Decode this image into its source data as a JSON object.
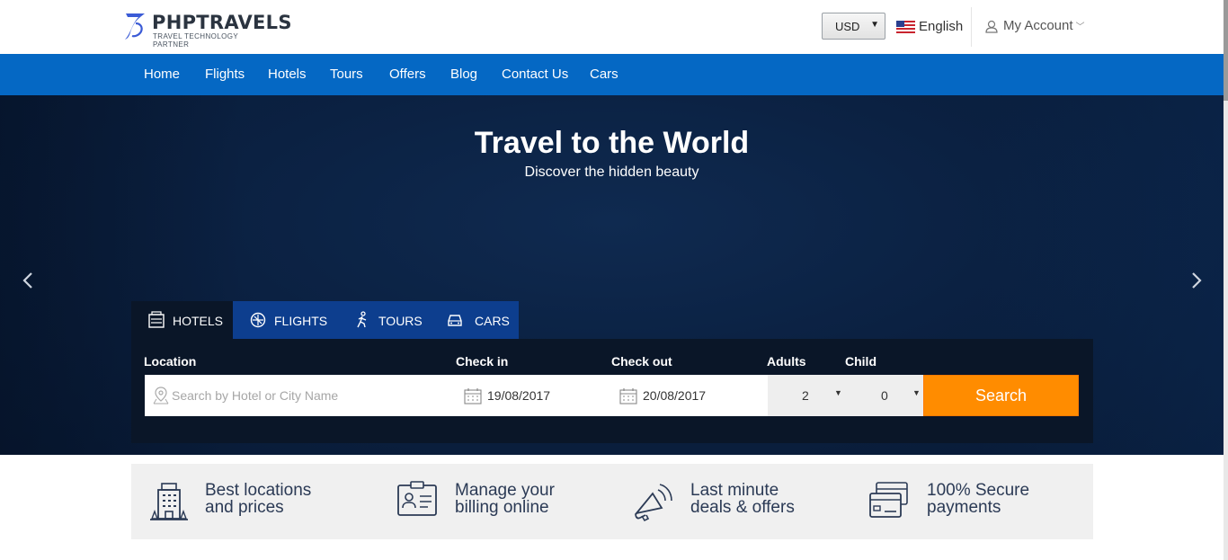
{
  "brand": {
    "name": "PHPTRAVELS",
    "tagline": "TRAVEL TECHNOLOGY PARTNER",
    "accent": "#0568c4",
    "logo_color": "#3b5bd6"
  },
  "topbar": {
    "currency": "USD",
    "language": "English",
    "account": "My Account"
  },
  "nav": {
    "items": [
      "Home",
      "Flights",
      "Hotels",
      "Tours",
      "Offers",
      "Blog",
      "Contact Us",
      "Cars"
    ]
  },
  "hero": {
    "title": "Travel to the World",
    "subtitle": "Discover the hidden beauty"
  },
  "tabs": [
    {
      "label": "HOTELS",
      "icon": "hotel-icon",
      "active": true
    },
    {
      "label": "FLIGHTS",
      "icon": "airplane-icon",
      "active": false
    },
    {
      "label": "TOURS",
      "icon": "hiker-icon",
      "active": false
    },
    {
      "label": "CARS",
      "icon": "car-icon",
      "active": false
    }
  ],
  "search": {
    "labels": {
      "location": "Location",
      "checkin": "Check in",
      "checkout": "Check out",
      "adults": "Adults",
      "child": "Child"
    },
    "location_placeholder": "Search by Hotel or City Name",
    "checkin_value": "19/08/2017",
    "checkout_value": "20/08/2017",
    "adults_value": "2",
    "child_value": "0",
    "button": "Search",
    "button_color": "#ff8c00"
  },
  "features": [
    {
      "line1": "Best locations",
      "line2": "and prices",
      "icon": "building-icon"
    },
    {
      "line1": "Manage your",
      "line2": "billing online",
      "icon": "id-card-icon"
    },
    {
      "line1": "Last minute",
      "line2": "deals & offers",
      "icon": "megaphone-icon"
    },
    {
      "line1": "100% Secure",
      "line2": "payments",
      "icon": "credit-card-icon"
    }
  ]
}
